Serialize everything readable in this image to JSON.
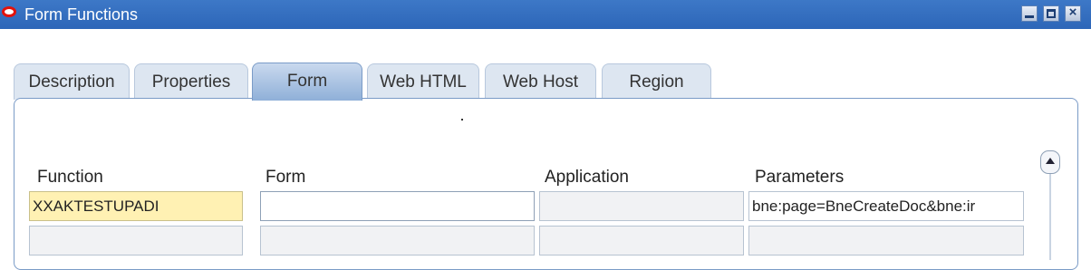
{
  "window": {
    "title": "Form Functions",
    "controls": [
      "minimize",
      "maximize",
      "close"
    ]
  },
  "tabs": [
    {
      "label": "Description",
      "active": false
    },
    {
      "label": "Properties",
      "active": false
    },
    {
      "label": "Form",
      "active": true
    },
    {
      "label": "Web HTML",
      "active": false
    },
    {
      "label": "Web Host",
      "active": false
    },
    {
      "label": "Region",
      "active": false
    }
  ],
  "columns": {
    "function": "Function",
    "form": "Form",
    "application": "Application",
    "parameters": "Parameters"
  },
  "rows": [
    {
      "function": "XXAKTESTUPADI",
      "form": "",
      "application": "",
      "parameters": "bne:page=BneCreateDoc&bne:ir"
    },
    {
      "function": "",
      "form": "",
      "application": "",
      "parameters": ""
    }
  ],
  "colors": {
    "titlebar": "#2d66b8",
    "required_field": "#fff1b3",
    "active_tab": "#8fb0d8"
  }
}
